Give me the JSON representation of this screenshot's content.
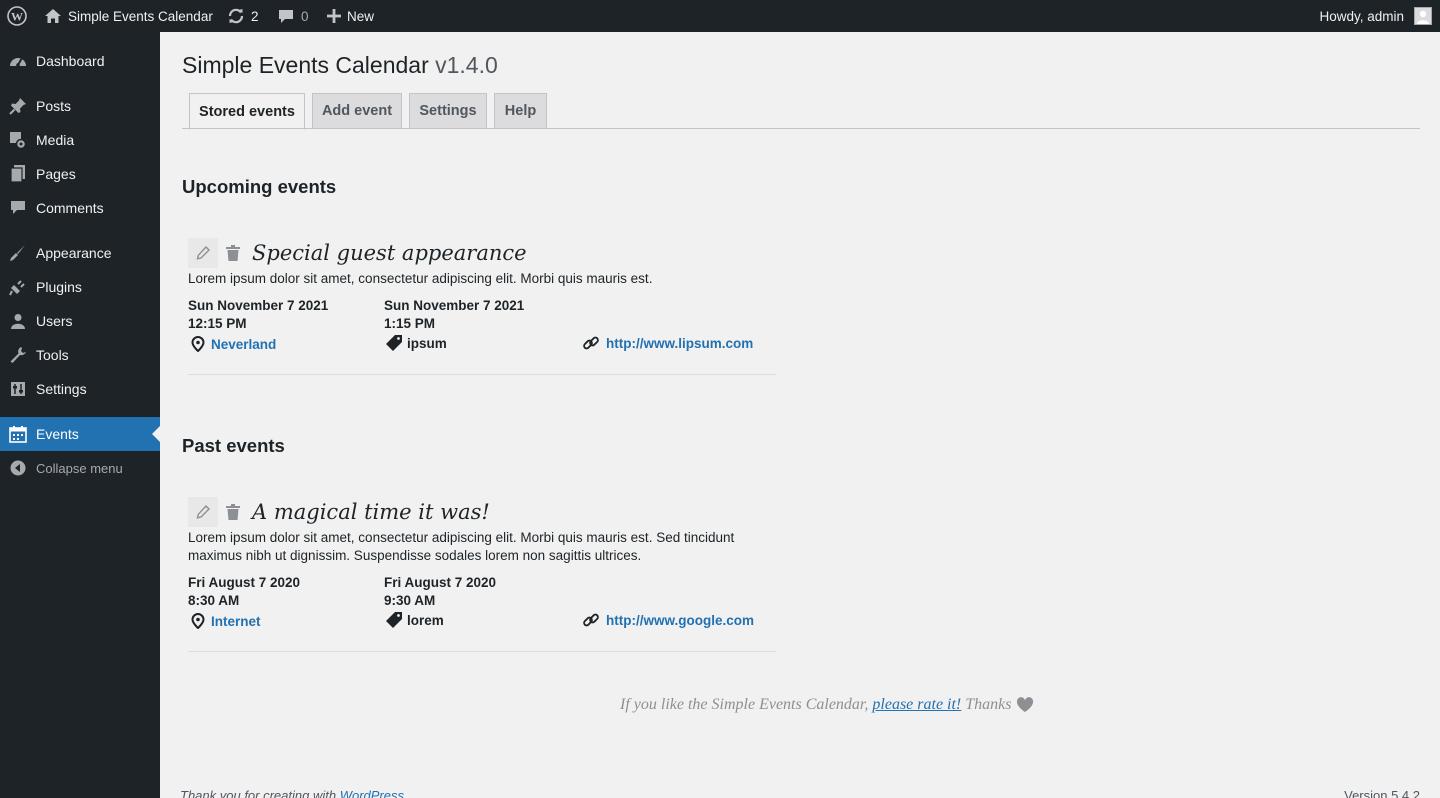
{
  "admin_bar": {
    "site_name": "Simple Events Calendar",
    "updates_count": "2",
    "comments_count": "0",
    "new_label": "New",
    "greeting": "Howdy, admin"
  },
  "sidebar": {
    "items": [
      {
        "label": "Dashboard",
        "icon": "dashboard-icon"
      },
      {
        "label": "Posts",
        "icon": "pin-icon"
      },
      {
        "label": "Media",
        "icon": "media-icon"
      },
      {
        "label": "Pages",
        "icon": "pages-icon"
      },
      {
        "label": "Comments",
        "icon": "comment-icon"
      },
      {
        "label": "Appearance",
        "icon": "brush-icon"
      },
      {
        "label": "Plugins",
        "icon": "plug-icon"
      },
      {
        "label": "Users",
        "icon": "user-icon"
      },
      {
        "label": "Tools",
        "icon": "wrench-icon"
      },
      {
        "label": "Settings",
        "icon": "sliders-icon"
      },
      {
        "label": "Events",
        "icon": "calendar-icon"
      }
    ],
    "collapse_label": "Collapse menu"
  },
  "page": {
    "title": "Simple Events Calendar",
    "version": "v1.4.0",
    "tabs": [
      "Stored events",
      "Add event",
      "Settings",
      "Help"
    ],
    "active_tab": "Stored events"
  },
  "upcoming": {
    "heading": "Upcoming events",
    "events": [
      {
        "title": "Special guest appearance",
        "description": "Lorem ipsum dolor sit amet, consectetur adipiscing elit. Morbi quis mauris est.",
        "start_date": "Sun November 7 2021",
        "start_time": "12:15 PM",
        "end_date": "Sun November 7 2021",
        "end_time": "1:15 PM",
        "location": "Neverland",
        "category": "ipsum",
        "url": "http://www.lipsum.com"
      }
    ]
  },
  "past": {
    "heading": "Past events",
    "events": [
      {
        "title": "A magical time it was!",
        "description": "Lorem ipsum dolor sit amet, consectetur adipiscing elit. Morbi quis mauris est. Sed tincidunt maximus nibh ut dignissim. Suspendisse sodales lorem non sagittis ultrices.",
        "start_date": "Fri August 7 2020",
        "start_time": "8:30 AM",
        "end_date": "Fri August 7 2020",
        "end_time": "9:30 AM",
        "location": "Internet",
        "category": "lorem",
        "url": "http://www.google.com"
      }
    ]
  },
  "rate": {
    "prefix": "If you like the Simple Events Calendar,",
    "link": "please rate it!",
    "suffix": "Thanks"
  },
  "footer": {
    "thanks": "Thank you for creating with",
    "wp_link": "WordPress",
    "version": "Version 5.4.2"
  },
  "colors": {
    "admin_dark": "#1d2327",
    "accent": "#2271b1",
    "background": "#f1f1f1"
  }
}
